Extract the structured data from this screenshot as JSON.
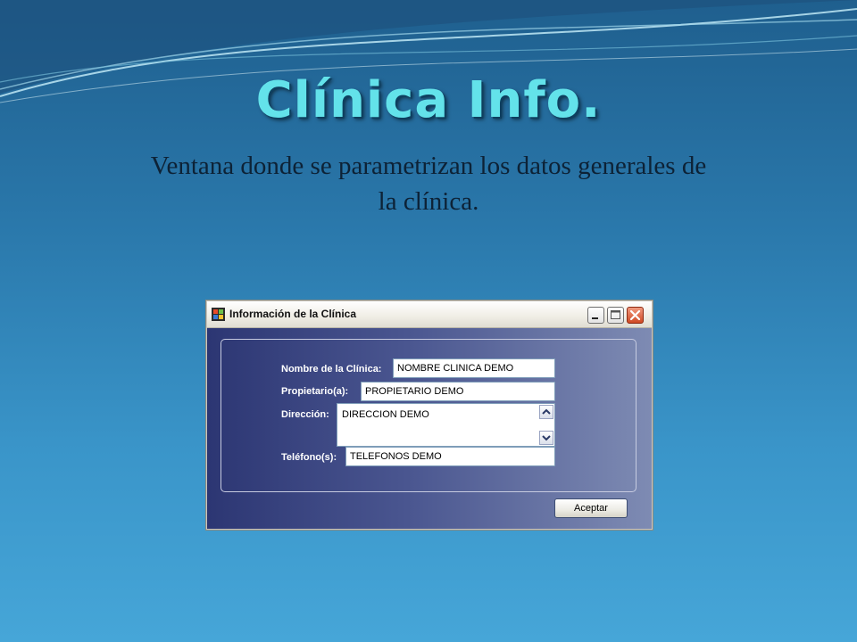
{
  "slide": {
    "title": "Clínica Info.",
    "subtitle_line1": "Ventana donde se parametrizan los datos generales de",
    "subtitle_line2": "la clínica."
  },
  "window": {
    "title": "Información de la Clínica",
    "icons": {
      "app": "app-window-icon",
      "minimize": "minimize-icon",
      "maximize": "maximize-icon",
      "close": "close-icon"
    }
  },
  "form": {
    "clinic_name": {
      "label": "Nombre de la Clínica:",
      "value": "NOMBRE CLINICA DEMO"
    },
    "owner": {
      "label": "Propietario(a):",
      "value": "PROPIETARIO DEMO"
    },
    "address": {
      "label": "Dirección:",
      "value": "DIRECCION DEMO"
    },
    "phones": {
      "label": "Teléfono(s):",
      "value": "TELEFONOS DEMO"
    }
  },
  "buttons": {
    "accept": "Aceptar"
  },
  "colors": {
    "title": "#63e2ea",
    "window_bg": "#2c3673",
    "accent_close": "#d04a24"
  }
}
